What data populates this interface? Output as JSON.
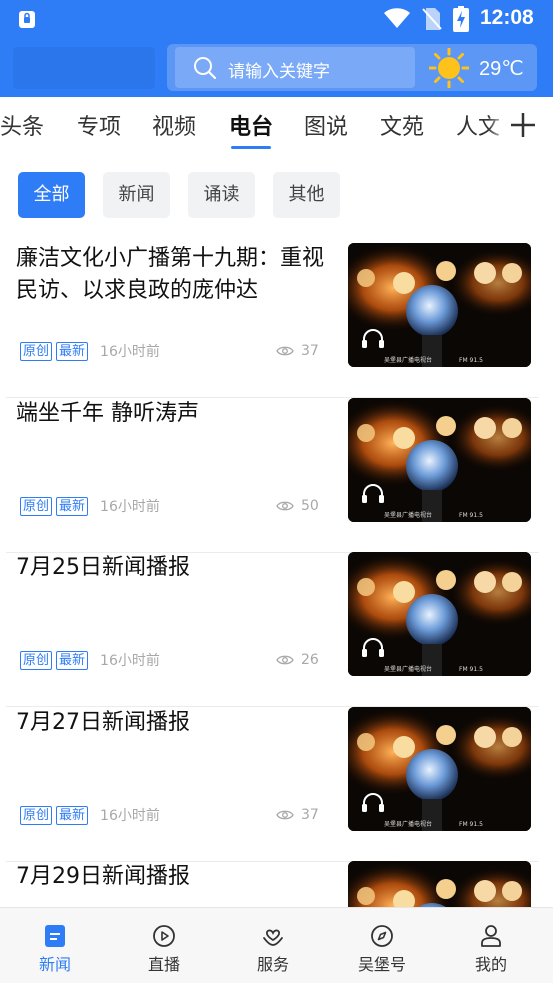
{
  "status_bar": {
    "time": "12:08"
  },
  "search": {
    "placeholder": "请输入关键字"
  },
  "weather": {
    "temperature": "29℃"
  },
  "tabs": [
    {
      "label": "头条"
    },
    {
      "label": "专项"
    },
    {
      "label": "视频"
    },
    {
      "label": "电台",
      "active": true
    },
    {
      "label": "图说"
    },
    {
      "label": "文苑"
    },
    {
      "label": "人文"
    }
  ],
  "filters": [
    {
      "label": "全部",
      "active": true
    },
    {
      "label": "新闻"
    },
    {
      "label": "诵读"
    },
    {
      "label": "其他"
    }
  ],
  "news": [
    {
      "title": "廉洁文化小广播第十九期：重视民访、以求良政的庞仲达",
      "tags": [
        "原创",
        "最新"
      ],
      "time": "16小时前",
      "views": "37"
    },
    {
      "title": "端坐千年 静听涛声",
      "tags": [
        "原创",
        "最新"
      ],
      "time": "16小时前",
      "views": "50"
    },
    {
      "title": "7月25日新闻播报",
      "tags": [
        "原创",
        "最新"
      ],
      "time": "16小时前",
      "views": "26"
    },
    {
      "title": "7月27日新闻播报",
      "tags": [
        "原创",
        "最新"
      ],
      "time": "16小时前",
      "views": "37"
    },
    {
      "title": "7月29日新闻播报",
      "tags": [],
      "time": "",
      "views": ""
    }
  ],
  "thumbnail": {
    "station_text": "吴堡县广播电视台",
    "fm_text": "FM 91.5"
  },
  "bottom_nav": [
    {
      "label": "新闻",
      "icon": "news-icon",
      "active": true
    },
    {
      "label": "直播",
      "icon": "play-icon"
    },
    {
      "label": "服务",
      "icon": "service-icon"
    },
    {
      "label": "吴堡号",
      "icon": "compass-icon"
    },
    {
      "label": "我的",
      "icon": "user-icon"
    }
  ],
  "colors": {
    "primary": "#2f7df6",
    "tag": "#2f7df6",
    "muted": "#a8a8a8"
  }
}
